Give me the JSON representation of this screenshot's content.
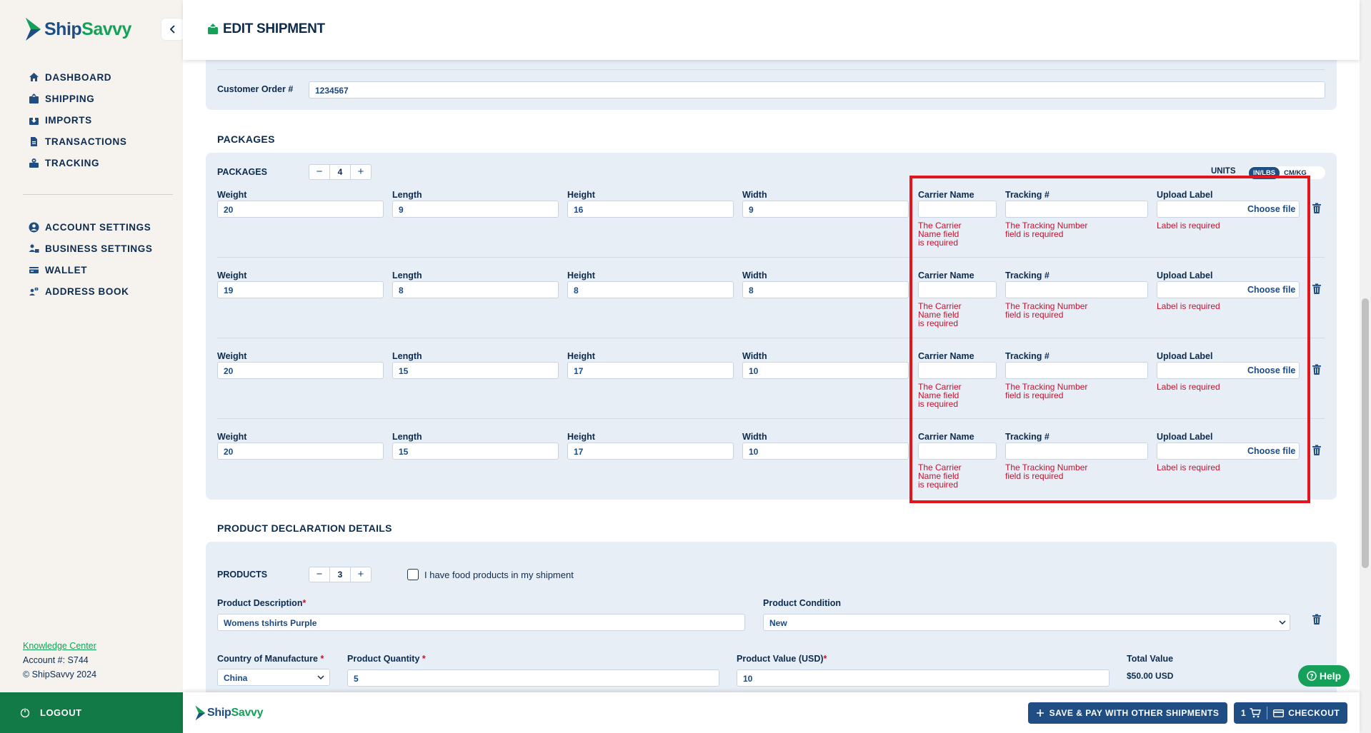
{
  "brand": {
    "name_part1": "Ship",
    "name_part2": "Savvy",
    "accent": "#15a15a",
    "primary": "#1e4e84"
  },
  "sidebar": {
    "nav_main": [
      {
        "label": "DASHBOARD",
        "icon": "home-icon"
      },
      {
        "label": "SHIPPING",
        "icon": "box-out-icon"
      },
      {
        "label": "IMPORTS",
        "icon": "box-in-icon"
      },
      {
        "label": "TRANSACTIONS",
        "icon": "document-icon"
      },
      {
        "label": "TRACKING",
        "icon": "tracking-icon"
      }
    ],
    "nav_settings": [
      {
        "label": "ACCOUNT SETTINGS",
        "icon": "user-circle-icon"
      },
      {
        "label": "BUSINESS SETTINGS",
        "icon": "business-icon"
      },
      {
        "label": "WALLET",
        "icon": "wallet-icon"
      },
      {
        "label": "ADDRESS BOOK",
        "icon": "address-book-icon"
      }
    ],
    "knowledge_center": "Knowledge Center",
    "account": "Account #: S744",
    "copyright": "© ShipSavvy 2024",
    "logout": "LOGOUT"
  },
  "header": {
    "title": "EDIT SHIPMENT"
  },
  "order": {
    "label": "Customer Order #",
    "value": "1234567"
  },
  "packages": {
    "section_title": "PACKAGES",
    "count_label": "PACKAGES",
    "count": "4",
    "units_label": "UNITS",
    "units_on": "IN/LBS",
    "units_off": "CM/KG",
    "field_labels": {
      "weight": "Weight",
      "length": "Length",
      "height": "Height",
      "width": "Width",
      "carrier": "Carrier Name",
      "tracking": "Tracking #",
      "upload": "Upload Label"
    },
    "choose_file": "Choose file",
    "errors": {
      "carrier": [
        "The Carrier",
        "Name field",
        "is required"
      ],
      "tracking": [
        "The Tracking Number",
        "field is required"
      ],
      "label": "Label is required"
    },
    "rows": [
      {
        "weight": "20",
        "length": "9",
        "height": "16",
        "width": "9"
      },
      {
        "weight": "19",
        "length": "8",
        "height": "8",
        "width": "8"
      },
      {
        "weight": "20",
        "length": "15",
        "height": "17",
        "width": "10"
      },
      {
        "weight": "20",
        "length": "15",
        "height": "17",
        "width": "10"
      }
    ]
  },
  "products": {
    "section_title": "PRODUCT DECLARATION DETAILS",
    "count_label": "PRODUCTS",
    "count": "3",
    "food_checkbox": "I have food products in my shipment",
    "description_label": "Product Description",
    "description": "Womens tshirts Purple",
    "condition_label": "Product Condition",
    "condition": "New",
    "country_label": "Country of Manufacture",
    "country": "China",
    "quantity_label": "Product Quantity",
    "quantity": "5",
    "value_label": "Product Value (USD)",
    "value": "10",
    "total_label": "Total Value",
    "total": "$50.00 USD",
    "required_mark": "*"
  },
  "help": "Help",
  "footer": {
    "save_button": "SAVE & PAY WITH OTHER SHIPMENTS",
    "cart_count": "1",
    "checkout": "CHECKOUT"
  }
}
